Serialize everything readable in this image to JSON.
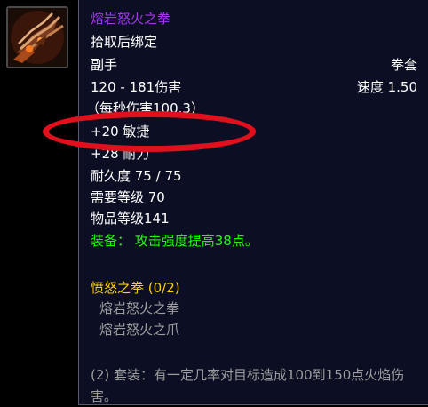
{
  "item_icon": "gauntlet-claw-icon",
  "tooltip": {
    "name": "熔岩怒火之拳",
    "name_color": "#a335ee",
    "binding": "拾取后绑定",
    "slot": "副手",
    "type": "拳套",
    "damage": "120 - 181伤害",
    "speed": "速度 1.50",
    "dps": "（每秒伤害100.3）",
    "stats": [
      "+20 敏捷",
      "+28 耐力"
    ],
    "durability": "耐久度 75 / 75",
    "required_level": "需要等级 70",
    "item_level": "物品等级141",
    "equip_effect": "装备： 攻击强度提高38点。",
    "set": {
      "name": "愤怒之拳 (0/2)",
      "items": [
        "熔岩怒火之拳",
        "熔岩怒火之爪"
      ],
      "bonus": "(2) 套装：有一定几率对目标造成100到150点火焰伤害。"
    }
  },
  "annotation_color": "#e0101c"
}
